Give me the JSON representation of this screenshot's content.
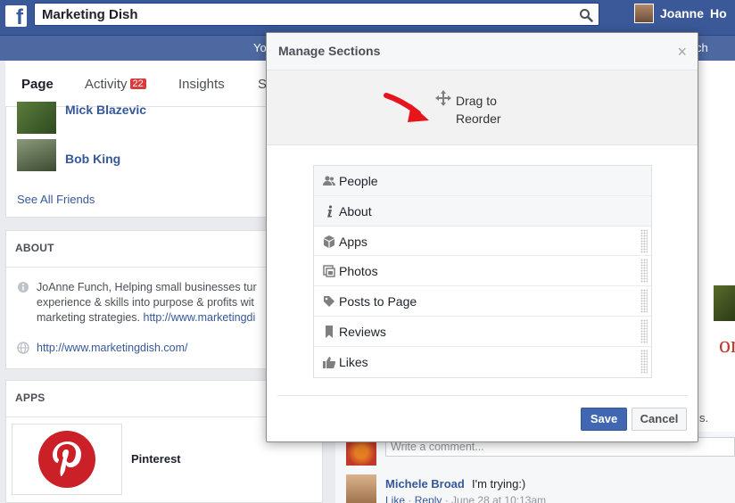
{
  "topbar": {
    "logo": "f",
    "search_value": "Marketing Dish",
    "user_name": "Joanne",
    "home_label": "Ho"
  },
  "subbar": {
    "you": "Yo",
    "right_fragment": "ch"
  },
  "tabs": [
    {
      "label": "Page"
    },
    {
      "label": "Activity",
      "badge": "22"
    },
    {
      "label": "Insights"
    },
    {
      "label": "S"
    }
  ],
  "friends": {
    "items": [
      {
        "name": "Mick Blazevic"
      },
      {
        "name": "Bob King"
      }
    ],
    "see_all": "See All Friends"
  },
  "about": {
    "title": "ABOUT",
    "line1": "JoAnne Funch, Helping small businesses tur",
    "line2": "experience & skills into purpose & profits wit",
    "line3_text": "marketing strategies. ",
    "line3_link": "http://www.marketingdi",
    "url": "http://www.marketingdish.com/"
  },
  "apps": {
    "title": "APPS",
    "app_name": "Pinterest"
  },
  "feed": {
    "comment_placeholder": "Write a comment...",
    "author": "Michele Broad",
    "comment": "I'm trying:)",
    "like": "Like",
    "reply": "Reply",
    "time": " · June 28 at 10:13am",
    "fragment_s": "s.",
    "fragment_om": "om"
  },
  "modal": {
    "title": "Manage Sections",
    "close": "×",
    "drag_line1": "Drag to",
    "drag_line2": "Reorder",
    "sections": [
      {
        "label": "People",
        "icon": "people-icon",
        "locked": true
      },
      {
        "label": "About",
        "icon": "info-icon",
        "locked": true
      },
      {
        "label": "Apps",
        "icon": "cube-icon",
        "locked": false
      },
      {
        "label": "Photos",
        "icon": "photos-icon",
        "locked": false
      },
      {
        "label": "Posts to Page",
        "icon": "tag-icon",
        "locked": false
      },
      {
        "label": "Reviews",
        "icon": "bookmark-icon",
        "locked": false
      },
      {
        "label": "Likes",
        "icon": "thumbs-up-icon",
        "locked": false
      }
    ],
    "save_label": "Save",
    "cancel_label": "Cancel"
  },
  "colors": {
    "brand": "#3b5998",
    "link": "#365899",
    "primary_button": "#4267b2",
    "badge": "#d93a3a",
    "arrow": "#e8141c"
  }
}
